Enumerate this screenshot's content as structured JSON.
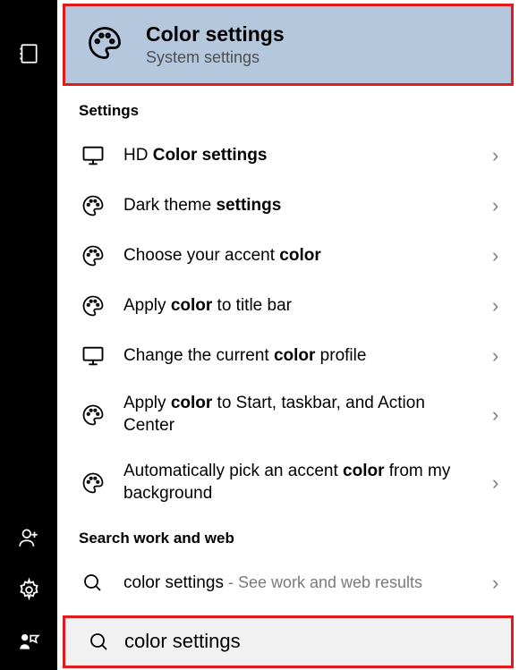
{
  "sidebar": {
    "icons": [
      "journal",
      "people",
      "gear",
      "feedback"
    ]
  },
  "bestMatch": {
    "title": "Color settings",
    "subtitle": "System settings",
    "icon": "palette"
  },
  "sections": [
    {
      "header": "Settings",
      "items": [
        {
          "pre": "HD ",
          "bold": "Color settings",
          "post": "",
          "icon": "monitor"
        },
        {
          "pre": "Dark theme ",
          "bold": "settings",
          "post": "",
          "icon": "palette"
        },
        {
          "pre": "Choose your accent ",
          "bold": "color",
          "post": "",
          "icon": "palette"
        },
        {
          "pre": "Apply ",
          "bold": "color",
          "post": " to title bar",
          "icon": "palette"
        },
        {
          "pre": "Change the current ",
          "bold": "color",
          "post": " profile",
          "icon": "monitor"
        },
        {
          "pre": "Apply ",
          "bold": "color",
          "post": " to Start, taskbar, and Action Center",
          "icon": "palette",
          "tall": true
        },
        {
          "pre": "Automatically pick an accent ",
          "bold": "color",
          "post": " from my background",
          "icon": "palette",
          "tall": true
        }
      ]
    },
    {
      "header": "Search work and web",
      "items": [
        {
          "pre": "color settings",
          "bold": "",
          "post": "",
          "suffix": " - See work and web results",
          "icon": "search"
        }
      ]
    }
  ],
  "searchBar": {
    "value": "color settings",
    "icon": "search"
  }
}
